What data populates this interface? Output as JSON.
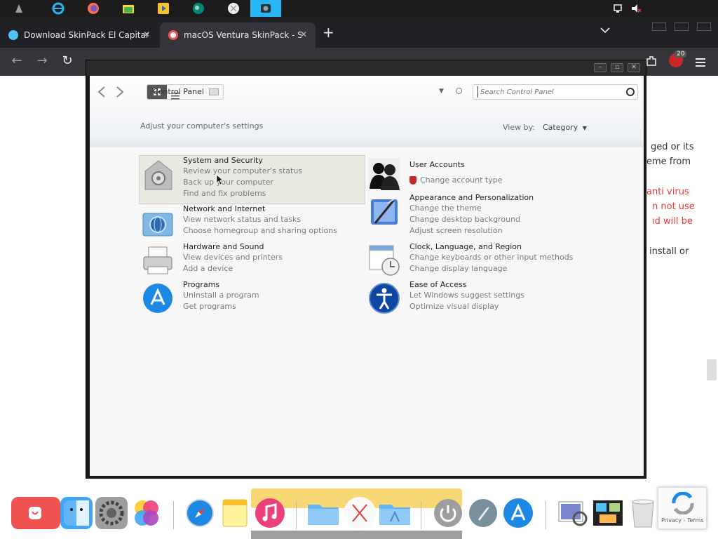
{
  "taskbar": {
    "icons": [
      "launcher-icon",
      "internet-explorer-icon",
      "firefox-icon",
      "files-icon",
      "media-player-icon",
      "green-app-icon",
      "safari-like-icon",
      "camera-icon"
    ],
    "tray": [
      "network-icon",
      "volume-muted-icon"
    ]
  },
  "browser": {
    "tabs": [
      {
        "label": "Download SkinPack El Capitan by",
        "active": false
      },
      {
        "label": "macOS Ventura SkinPack - SkinPa",
        "active": true
      }
    ],
    "new_tab": "+",
    "extension_badge": "20",
    "page_text": [
      "ged or its",
      "eme from",
      "anti virus",
      "n not use",
      "ıd will be",
      "install or"
    ]
  },
  "control_panel": {
    "address": "Control Panel",
    "search_placeholder": "Search Control Panel",
    "header_text": "Adjust your computer's settings",
    "view_by_label": "View by:",
    "view_by_value": "Category",
    "categories": [
      {
        "title": "System and Security",
        "links": [
          "Review your computer's status",
          "Back up your computer",
          "Find and fix problems"
        ]
      },
      {
        "title": "Network and Internet",
        "links": [
          "View network status and tasks",
          "Choose homegroup and sharing options"
        ]
      },
      {
        "title": "Hardware and Sound",
        "links": [
          "View devices and printers",
          "Add a device"
        ]
      },
      {
        "title": "Programs",
        "links": [
          "Uninstall a program",
          "Get programs"
        ]
      },
      {
        "title": "User Accounts",
        "links": [
          "Change account type"
        ]
      },
      {
        "title": "Appearance and Personalization",
        "links": [
          "Change the theme",
          "Change desktop background",
          "Adjust screen resolution"
        ]
      },
      {
        "title": "Clock, Language, and Region",
        "links": [
          "Change keyboards or other input methods",
          "Change display language"
        ]
      },
      {
        "title": "Ease of Access",
        "links": [
          "Let Windows suggest settings",
          "Optimize visual display"
        ]
      }
    ]
  },
  "recaptcha": {
    "text": "Privacy - Terms"
  },
  "colors": {
    "accent_red": "#e53935",
    "link_gray": "#7a7a7a",
    "browser_dark": "#202124"
  }
}
